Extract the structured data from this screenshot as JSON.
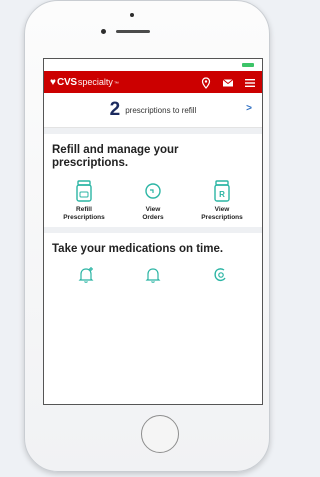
{
  "brand": {
    "heart": "♥",
    "name": "CVS",
    "sub": "specialty",
    "tm": "™",
    "accent": "#cc0000"
  },
  "navbar": {
    "icons": [
      "location-icon",
      "mail-icon",
      "menu-icon"
    ]
  },
  "refill": {
    "count": "2",
    "text": "prescriptions to refill",
    "chevron": ">"
  },
  "manage": {
    "title": "Refill and manage your prescriptions.",
    "actions": [
      {
        "label": "Refill\nPrescriptions",
        "icon": "pill-bottle-icon"
      },
      {
        "label": "View\nOrders",
        "icon": "orders-icon"
      },
      {
        "label": "View\nPrescriptions",
        "icon": "prescription-icon"
      }
    ]
  },
  "medications": {
    "title": "Take your medications on time.",
    "icons": [
      "add-reminder-bell-icon",
      "bell-icon",
      "refresh-icon"
    ]
  },
  "colors": {
    "teal": "#2bb5a4",
    "navy": "#1b2a5e",
    "link": "#2f6fc2"
  }
}
